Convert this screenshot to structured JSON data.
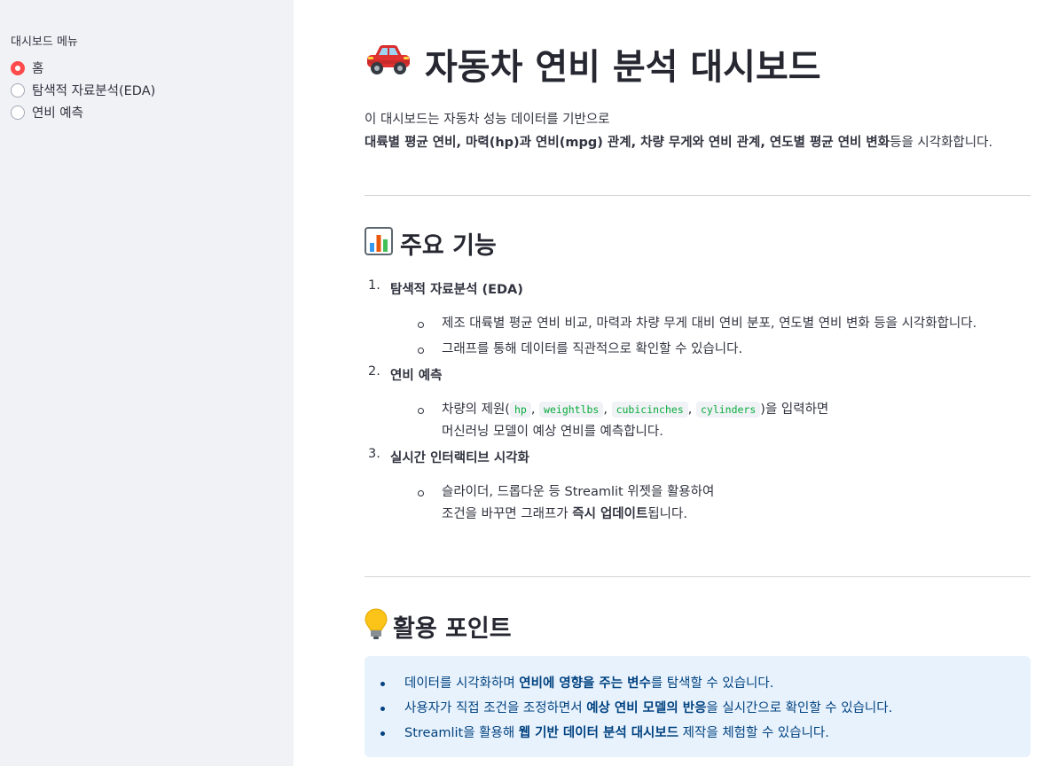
{
  "sidebar": {
    "label": "대시보드 메뉴",
    "options": [
      {
        "label": "홈",
        "selected": true
      },
      {
        "label": "탐색적 자료분석(EDA)",
        "selected": false
      },
      {
        "label": "연비 예측",
        "selected": false
      }
    ]
  },
  "header": {
    "emoji": "🚗",
    "title": "자동차 연비 분석 대시보드"
  },
  "intro": {
    "line1": "이 대시보드는 자동차 성능 데이터를 기반으로",
    "line2_bold": "대륙별 평균 연비, 마력(hp)과 연비(mpg) 관계, 차량 무게와 연비 관계, 연도별 평균 연비 변화",
    "line2_rest": "등을 시각화합니다."
  },
  "features": {
    "emoji": "📊",
    "title": "주요 기능",
    "items": [
      {
        "num": "1.",
        "title_bold": "탐색적 자료분석",
        "title_rest": " (EDA)",
        "bullets": [
          "제조 대륙별 평균 연비 비교, 마력과 차량 무게 대비 연비 분포, 연도별 연비 변화 등을 시각화합니다.",
          "그래프를 통해 데이터를 직관적으로 확인할 수 있습니다."
        ]
      },
      {
        "num": "2.",
        "title": "연비 예측",
        "bullet_prefix": "차량의 제원(",
        "codes": [
          "hp",
          "weightlbs",
          "cubicinches",
          "cylinders"
        ],
        "bullet_suffix": ")을 입력하면",
        "bullet_line2": "머신러닝 모델이 예상 연비를 예측합니다."
      },
      {
        "num": "3.",
        "title": "실시간 인터랙티브 시각화",
        "bullet_line1": "슬라이더, 드롭다운 등 Streamlit 위젯을 활용하여",
        "bullet_line2_pre": "조건을 바꾸면 그래프가 ",
        "bullet_line2_bold": "즉시 업데이트",
        "bullet_line2_post": "됩니다."
      }
    ]
  },
  "points": {
    "emoji": "💡",
    "title": "활용 포인트",
    "items": [
      {
        "pre": "데이터를 시각화하며 ",
        "bold": "연비에 영향을 주는 변수",
        "post": "를 탐색할 수 있습니다."
      },
      {
        "pre": "사용자가 직접 조건을 조정하면서 ",
        "bold": "예상 연비 모델의 반응",
        "post": "을 실시간으로 확인할 수 있습니다."
      },
      {
        "pre": "Streamlit을 활용해 ",
        "bold": "웹 기반 데이터 분석 대시보드",
        "post": " 제작을 체험할 수 있습니다."
      }
    ]
  },
  "colors": {
    "accent": "#ff4b4b",
    "sidebar_bg": "#f0f2f6",
    "info_bg": "#e8f2fc",
    "info_text": "#004280",
    "code_text": "#09ab3b"
  }
}
